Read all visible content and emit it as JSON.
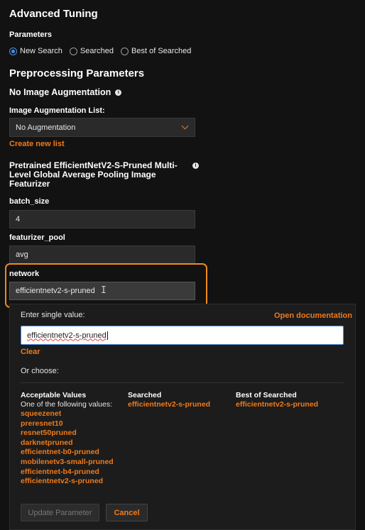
{
  "page": {
    "title": "Advanced Tuning"
  },
  "parameters": {
    "label": "Parameters",
    "options": [
      "New Search",
      "Searched",
      "Best of Searched"
    ],
    "selected": "New Search"
  },
  "preprocessing": {
    "title": "Preprocessing Parameters",
    "no_aug_title": "No Image Augmentation",
    "aug_list_label": "Image Augmentation List:",
    "aug_list_value": "No Augmentation",
    "create_link": "Create new list"
  },
  "featurizer": {
    "title": "Pretrained EfficientNetV2-S-Pruned Multi-Level Global Average Pooling Image Featurizer",
    "batch_size_label": "batch_size",
    "batch_size_value": "4",
    "pool_label": "featurizer_pool",
    "pool_value": "avg",
    "network_label": "network",
    "network_value": "efficientnetv2-s-pruned"
  },
  "editor": {
    "enter_label": "Enter single value:",
    "doc_link": "Open documentation",
    "input_value": "efficientnetv2-s-pruned",
    "clear": "Clear",
    "or_choose": "Or choose:",
    "acceptable_header": "Acceptable Values",
    "acceptable_sub": "One of the following values:",
    "acceptable_values": [
      "squeezenet",
      "preresnet10",
      "resnet50pruned",
      "darknetpruned",
      "efficientnet-b0-pruned",
      "mobilenetv3-small-pruned",
      "efficientnet-b4-pruned",
      "efficientnetv2-s-pruned"
    ],
    "searched_header": "Searched",
    "searched_value": "efficientnetv2-s-pruned",
    "best_header": "Best of Searched",
    "best_value": "efficientnetv2-s-pruned",
    "update_btn": "Update Parameter",
    "cancel_btn": "Cancel"
  },
  "colors": {
    "accent": "#f07a1a",
    "highlight": "#f08a1a",
    "radio": "#4a90e2",
    "background": "#121212"
  }
}
